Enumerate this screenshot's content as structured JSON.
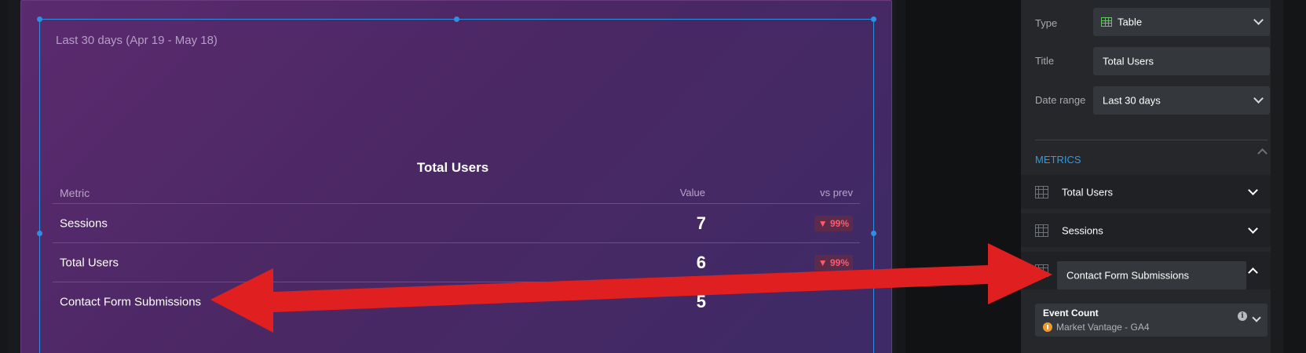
{
  "widget": {
    "date_range_label": "Last 30 days (Apr 19 - May 18)",
    "title": "Total Users",
    "columns": {
      "metric": "Metric",
      "value": "Value",
      "vs_prev": "vs prev"
    },
    "rows": [
      {
        "metric": "Sessions",
        "value": "7",
        "change": "▼ 99%"
      },
      {
        "metric": "Total Users",
        "value": "6",
        "change": "▼ 99%"
      },
      {
        "metric": "Contact Form Submissions",
        "value": "5",
        "change": ""
      }
    ],
    "colors": {
      "change_negative": "#ff5a6a",
      "selection": "#2f8fe0"
    }
  },
  "panel": {
    "type": {
      "label": "Type",
      "value": "Table",
      "icon": "table-icon"
    },
    "title": {
      "label": "Title",
      "value": "Total Users"
    },
    "date_range": {
      "label": "Date range",
      "value": "Last 30 days"
    },
    "metrics_section": {
      "header": "METRICS",
      "items": [
        {
          "label": "Total Users",
          "icon": "grid-icon",
          "expanded": false
        },
        {
          "label": "Sessions",
          "icon": "grid-icon",
          "expanded": false
        },
        {
          "label": "Contact Form Submissions",
          "icon": "grid-icon",
          "expanded": true
        }
      ]
    },
    "event": {
      "title": "Event Count",
      "source": "Market Vantage - GA4",
      "source_icon": "google-analytics-icon"
    },
    "colors": {
      "section_header": "#2f9be3",
      "annotation_arrow": "#e02020"
    }
  }
}
